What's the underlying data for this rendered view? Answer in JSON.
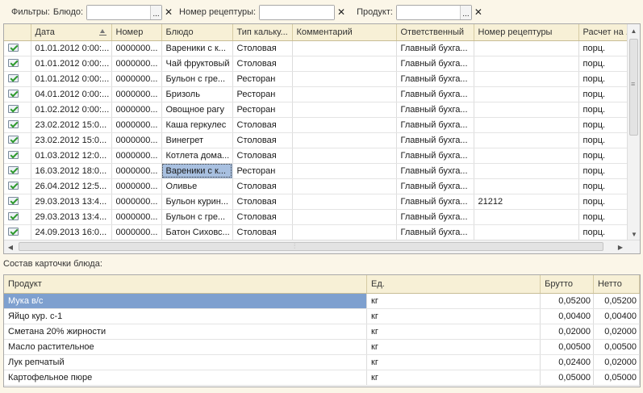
{
  "filters": {
    "label": "Фильтры:",
    "dish_label": "Блюдо:",
    "dish_value": "",
    "recipe_number_label": "Номер рецептуры:",
    "recipe_number_value": "",
    "product_label": "Продукт:",
    "product_value": "",
    "choose_glyph": "...",
    "clear_glyph": "✕"
  },
  "main_grid": {
    "columns": [
      "",
      "Дата",
      "Номер",
      "Блюдо",
      "Тип кальку...",
      "Комментарий",
      "Ответственный",
      "Номер рецептуры",
      "Расчет на ..."
    ],
    "rows": [
      {
        "date": "01.01.2012 0:00:...",
        "number": "0000000...",
        "dish": "Вареники с к...",
        "type": "Столовая",
        "comment": "",
        "responsible": "Главный бухга...",
        "recipe": "",
        "calc": "порц."
      },
      {
        "date": "01.01.2012 0:00:...",
        "number": "0000000...",
        "dish": "Чай фруктовый",
        "type": "Столовая",
        "comment": "",
        "responsible": "Главный бухга...",
        "recipe": "",
        "calc": "порц."
      },
      {
        "date": "01.01.2012 0:00:...",
        "number": "0000000...",
        "dish": "Бульон с гре...",
        "type": "Ресторан",
        "comment": "",
        "responsible": "Главный бухга...",
        "recipe": "",
        "calc": "порц."
      },
      {
        "date": "04.01.2012 0:00:...",
        "number": "0000000...",
        "dish": "Бризоль",
        "type": "Ресторан",
        "comment": "",
        "responsible": "Главный бухга...",
        "recipe": "",
        "calc": "порц."
      },
      {
        "date": "01.02.2012 0:00:...",
        "number": "0000000...",
        "dish": "Овощное рагу",
        "type": "Ресторан",
        "comment": "",
        "responsible": "Главный бухга...",
        "recipe": "",
        "calc": "порц."
      },
      {
        "date": "23.02.2012 15:0...",
        "number": "0000000...",
        "dish": "Каша геркулес",
        "type": "Столовая",
        "comment": "",
        "responsible": "Главный бухга...",
        "recipe": "",
        "calc": "порц."
      },
      {
        "date": "23.02.2012 15:0...",
        "number": "0000000...",
        "dish": "Винегрет",
        "type": "Столовая",
        "comment": "",
        "responsible": "Главный бухга...",
        "recipe": "",
        "calc": "порц."
      },
      {
        "date": "01.03.2012 12:0...",
        "number": "0000000...",
        "dish": "Котлета дома...",
        "type": "Столовая",
        "comment": "",
        "responsible": "Главный бухга...",
        "recipe": "",
        "calc": "порц."
      },
      {
        "date": "16.03.2012 18:0...",
        "number": "0000000...",
        "dish": "Вареники с к...",
        "type": "Ресторан",
        "comment": "",
        "responsible": "Главный бухга...",
        "recipe": "",
        "calc": "порц."
      },
      {
        "date": "26.04.2012 12:5...",
        "number": "0000000...",
        "dish": "Оливье",
        "type": "Столовая",
        "comment": "",
        "responsible": "Главный бухга...",
        "recipe": "",
        "calc": "порц."
      },
      {
        "date": "29.03.2013 13:4...",
        "number": "0000000...",
        "dish": "Бульон курин...",
        "type": "Столовая",
        "comment": "",
        "responsible": "Главный бухга...",
        "recipe": "21212",
        "calc": "порц."
      },
      {
        "date": "29.03.2013 13:4...",
        "number": "0000000...",
        "dish": "Бульон с гре...",
        "type": "Столовая",
        "comment": "",
        "responsible": "Главный бухга...",
        "recipe": "",
        "calc": "порц."
      },
      {
        "date": "24.09.2013 16:0...",
        "number": "0000000...",
        "dish": "Батон Сиховс...",
        "type": "Столовая",
        "comment": "",
        "responsible": "Главный бухга...",
        "recipe": "",
        "calc": "порц."
      }
    ],
    "current_row_index": 8,
    "row_icon": "posted-document-check-icon"
  },
  "section_title": "Состав карточки блюда:",
  "composition_grid": {
    "columns": [
      "Продукт",
      "Ед.",
      "Брутто",
      "Нетто"
    ],
    "rows": [
      {
        "product": "Мука в/с",
        "unit": "кг",
        "gross": "0,05200",
        "net": "0,05200"
      },
      {
        "product": "Яйцо кур. с-1",
        "unit": "кг",
        "gross": "0,00400",
        "net": "0,00400"
      },
      {
        "product": "Сметана 20% жирности",
        "unit": "кг",
        "gross": "0,02000",
        "net": "0,02000"
      },
      {
        "product": "Масло растительное",
        "unit": "кг",
        "gross": "0,00500",
        "net": "0,00500"
      },
      {
        "product": "Лук репчатый",
        "unit": "кг",
        "gross": "0,02400",
        "net": "0,02000"
      },
      {
        "product": "Картофельное пюре",
        "unit": "кг",
        "gross": "0,05000",
        "net": "0,05000"
      }
    ],
    "current_row_index": 0
  },
  "colors": {
    "header_bg": "#f7f0d6",
    "page_bg": "#fbf6e8",
    "selection": "#a8c0e0",
    "selection_dark": "#7ea0cf",
    "check_green": "#2e9a2e"
  }
}
